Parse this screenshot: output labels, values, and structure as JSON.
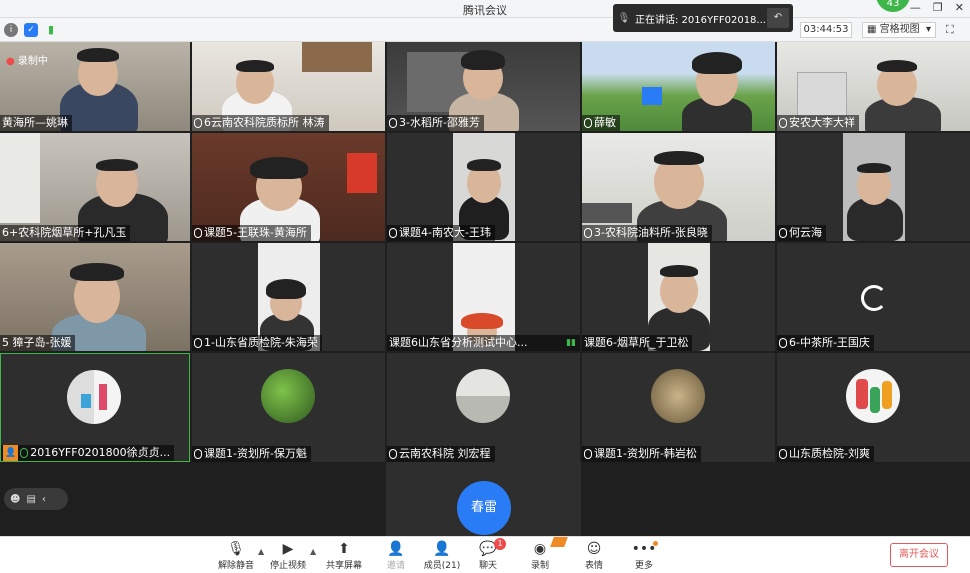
{
  "window": {
    "title": "腾讯会议"
  },
  "avatar_badge": "43",
  "status": {
    "speaking_label": "正在讲话: 2016YFF02018...",
    "timer": "03:44:53",
    "view_mode": "宫格视图"
  },
  "recording_label": "录制中",
  "tiles": [
    {
      "name": "黄海所—姚琳"
    },
    {
      "name": "6云南农科院质标所 林涛"
    },
    {
      "name": "3-水稻所-邵雅芳"
    },
    {
      "name": "薛敏"
    },
    {
      "name": "安农大李大祥"
    },
    {
      "name": "6+农科院烟草所+孔凡玉"
    },
    {
      "name": "课题5-王联珠-黄海所"
    },
    {
      "name": "课题4-南农大-王玮"
    },
    {
      "name": "3-农科院油料所-张良晓"
    },
    {
      "name": "何云海"
    },
    {
      "name": "5 獐子岛-张媛"
    },
    {
      "name": "1-山东省质检院-朱海荣"
    },
    {
      "name": "课题6山东省分析测试中心..."
    },
    {
      "name": "课题6-烟草所_于卫松"
    },
    {
      "name": "6-中茶所-王国庆"
    },
    {
      "name": "2016YFF0201800徐贞贞..."
    },
    {
      "name": "课题1-资划所-保万魁"
    },
    {
      "name": "云南农科院 刘宏程"
    },
    {
      "name": "课题1-资划所-韩岩松"
    },
    {
      "name": "山东质检院-刘爽"
    }
  ],
  "chun_tile": {
    "name": "春雷"
  },
  "toolbar": {
    "unmute": "解除静音",
    "stop_video": "停止视频",
    "share_screen": "共享屏幕",
    "invite": "邀请",
    "members": "成员(21)",
    "chat": "聊天",
    "chat_badge": "1",
    "record": "录制",
    "emoji": "表情",
    "more": "更多",
    "leave": "离开会议"
  }
}
